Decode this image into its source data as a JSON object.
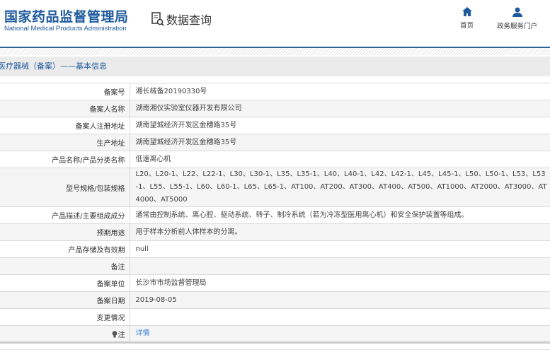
{
  "header": {
    "logo_cn": "国家药品监督管理局",
    "logo_en": "National Medical Products Administration",
    "data_query": "数据查询",
    "nav": [
      {
        "label": "首页",
        "icon": "home-icon"
      },
      {
        "label": "政务服务门户",
        "icon": "user-icon"
      }
    ]
  },
  "breadcrumb": "医疗器械（备案）——基本信息",
  "rows": [
    {
      "label": "备案号",
      "value": "湘长械备20190330号"
    },
    {
      "label": "备案人名称",
      "value": "湖南湘仪实验室仪器开发有限公司"
    },
    {
      "label": "备案人注册地址",
      "value": "湖南望城经济开发区金穗路35号"
    },
    {
      "label": "生产地址",
      "value": "湖南望城经济开发区金穗路35号"
    },
    {
      "label": "产品名称/产品分类名称",
      "value": "低速离心机"
    },
    {
      "label": "型号规格/包装规格",
      "value": "L20、L20-1、L22、L22-1、L30、L30-1、L35、L35-1、L40、L40-1、L42、L42-1、L45、L45-1、L50、L50-1、L53、L53-1、L55、L55-1、L60、L60-1、L65、L65-1、AT100、AT200、AT300、AT400、AT500、AT1000、AT2000、AT3000、AT4000、AT5000"
    },
    {
      "label": "产品描述/主要组成成分",
      "value": "通常由控制系统、离心腔、驱动系统、转子、制冷系统（若为冷冻型医用离心机）和安全保护装置等组成。"
    },
    {
      "label": "预期用途",
      "value": "用于样本分析前人体样本的分离。"
    },
    {
      "label": "产品存储及有效期",
      "value": "null"
    },
    {
      "label": "备注",
      "value": ""
    },
    {
      "label": "备案单位",
      "value": "长沙市市场监督管理局"
    },
    {
      "label": "备案日期",
      "value": "2019-08-05"
    },
    {
      "label": "变更情况",
      "value": ""
    },
    {
      "label": "注",
      "value": "详情"
    }
  ],
  "colors": {
    "brand": "#1f5a9e",
    "link": "#3a85d6"
  }
}
